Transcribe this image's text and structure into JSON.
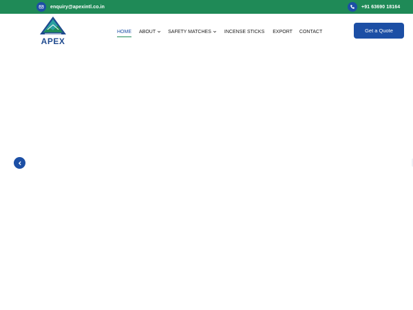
{
  "topbar": {
    "email": "enquiry@apexintl.co.in",
    "phone": "+91 63690 18164",
    "email_icon": "mail-icon",
    "phone_icon": "phone-icon",
    "background_color": "#1f8a57"
  },
  "header": {
    "logo_text": "APEX",
    "nav": [
      {
        "label": "HOME",
        "active": true
      },
      {
        "label": "ABOUT",
        "has_dropdown": true
      },
      {
        "label": "SAFETY MATCHES",
        "has_dropdown": true
      },
      {
        "label": "INCENSE STICKS"
      },
      {
        "label": "EXPORT"
      },
      {
        "label": "CONTACT"
      }
    ],
    "cta_label": "Get a Quote"
  },
  "slider": {
    "prev_icon": "chevron-left-icon"
  },
  "colors": {
    "accent": "#1c4fa5",
    "green": "#1f8a57"
  }
}
